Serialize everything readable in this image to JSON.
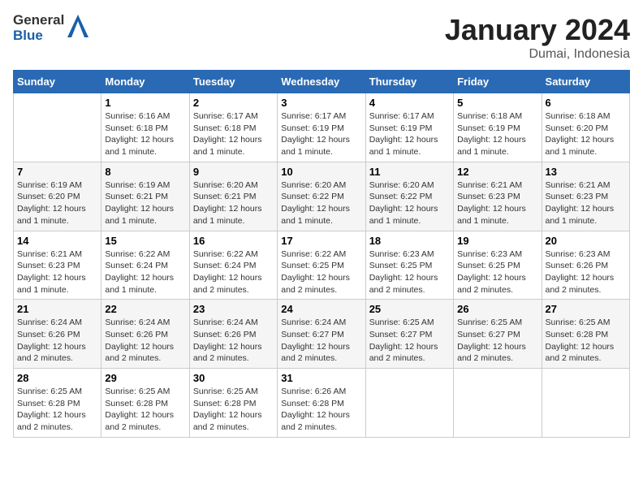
{
  "logo": {
    "line1": "General",
    "line2": "Blue"
  },
  "title": "January 2024",
  "subtitle": "Dumai, Indonesia",
  "headers": [
    "Sunday",
    "Monday",
    "Tuesday",
    "Wednesday",
    "Thursday",
    "Friday",
    "Saturday"
  ],
  "weeks": [
    [
      {
        "day": "",
        "info": ""
      },
      {
        "day": "1",
        "info": "Sunrise: 6:16 AM\nSunset: 6:18 PM\nDaylight: 12 hours\nand 1 minute."
      },
      {
        "day": "2",
        "info": "Sunrise: 6:17 AM\nSunset: 6:18 PM\nDaylight: 12 hours\nand 1 minute."
      },
      {
        "day": "3",
        "info": "Sunrise: 6:17 AM\nSunset: 6:19 PM\nDaylight: 12 hours\nand 1 minute."
      },
      {
        "day": "4",
        "info": "Sunrise: 6:17 AM\nSunset: 6:19 PM\nDaylight: 12 hours\nand 1 minute."
      },
      {
        "day": "5",
        "info": "Sunrise: 6:18 AM\nSunset: 6:19 PM\nDaylight: 12 hours\nand 1 minute."
      },
      {
        "day": "6",
        "info": "Sunrise: 6:18 AM\nSunset: 6:20 PM\nDaylight: 12 hours\nand 1 minute."
      }
    ],
    [
      {
        "day": "7",
        "info": "Sunrise: 6:19 AM\nSunset: 6:20 PM\nDaylight: 12 hours\nand 1 minute."
      },
      {
        "day": "8",
        "info": "Sunrise: 6:19 AM\nSunset: 6:21 PM\nDaylight: 12 hours\nand 1 minute."
      },
      {
        "day": "9",
        "info": "Sunrise: 6:20 AM\nSunset: 6:21 PM\nDaylight: 12 hours\nand 1 minute."
      },
      {
        "day": "10",
        "info": "Sunrise: 6:20 AM\nSunset: 6:22 PM\nDaylight: 12 hours\nand 1 minute."
      },
      {
        "day": "11",
        "info": "Sunrise: 6:20 AM\nSunset: 6:22 PM\nDaylight: 12 hours\nand 1 minute."
      },
      {
        "day": "12",
        "info": "Sunrise: 6:21 AM\nSunset: 6:23 PM\nDaylight: 12 hours\nand 1 minute."
      },
      {
        "day": "13",
        "info": "Sunrise: 6:21 AM\nSunset: 6:23 PM\nDaylight: 12 hours\nand 1 minute."
      }
    ],
    [
      {
        "day": "14",
        "info": "Sunrise: 6:21 AM\nSunset: 6:23 PM\nDaylight: 12 hours\nand 1 minute."
      },
      {
        "day": "15",
        "info": "Sunrise: 6:22 AM\nSunset: 6:24 PM\nDaylight: 12 hours\nand 1 minute."
      },
      {
        "day": "16",
        "info": "Sunrise: 6:22 AM\nSunset: 6:24 PM\nDaylight: 12 hours\nand 2 minutes."
      },
      {
        "day": "17",
        "info": "Sunrise: 6:22 AM\nSunset: 6:25 PM\nDaylight: 12 hours\nand 2 minutes."
      },
      {
        "day": "18",
        "info": "Sunrise: 6:23 AM\nSunset: 6:25 PM\nDaylight: 12 hours\nand 2 minutes."
      },
      {
        "day": "19",
        "info": "Sunrise: 6:23 AM\nSunset: 6:25 PM\nDaylight: 12 hours\nand 2 minutes."
      },
      {
        "day": "20",
        "info": "Sunrise: 6:23 AM\nSunset: 6:26 PM\nDaylight: 12 hours\nand 2 minutes."
      }
    ],
    [
      {
        "day": "21",
        "info": "Sunrise: 6:24 AM\nSunset: 6:26 PM\nDaylight: 12 hours\nand 2 minutes."
      },
      {
        "day": "22",
        "info": "Sunrise: 6:24 AM\nSunset: 6:26 PM\nDaylight: 12 hours\nand 2 minutes."
      },
      {
        "day": "23",
        "info": "Sunrise: 6:24 AM\nSunset: 6:26 PM\nDaylight: 12 hours\nand 2 minutes."
      },
      {
        "day": "24",
        "info": "Sunrise: 6:24 AM\nSunset: 6:27 PM\nDaylight: 12 hours\nand 2 minutes."
      },
      {
        "day": "25",
        "info": "Sunrise: 6:25 AM\nSunset: 6:27 PM\nDaylight: 12 hours\nand 2 minutes."
      },
      {
        "day": "26",
        "info": "Sunrise: 6:25 AM\nSunset: 6:27 PM\nDaylight: 12 hours\nand 2 minutes."
      },
      {
        "day": "27",
        "info": "Sunrise: 6:25 AM\nSunset: 6:28 PM\nDaylight: 12 hours\nand 2 minutes."
      }
    ],
    [
      {
        "day": "28",
        "info": "Sunrise: 6:25 AM\nSunset: 6:28 PM\nDaylight: 12 hours\nand 2 minutes."
      },
      {
        "day": "29",
        "info": "Sunrise: 6:25 AM\nSunset: 6:28 PM\nDaylight: 12 hours\nand 2 minutes."
      },
      {
        "day": "30",
        "info": "Sunrise: 6:25 AM\nSunset: 6:28 PM\nDaylight: 12 hours\nand 2 minutes."
      },
      {
        "day": "31",
        "info": "Sunrise: 6:26 AM\nSunset: 6:28 PM\nDaylight: 12 hours\nand 2 minutes."
      },
      {
        "day": "",
        "info": ""
      },
      {
        "day": "",
        "info": ""
      },
      {
        "day": "",
        "info": ""
      }
    ]
  ]
}
